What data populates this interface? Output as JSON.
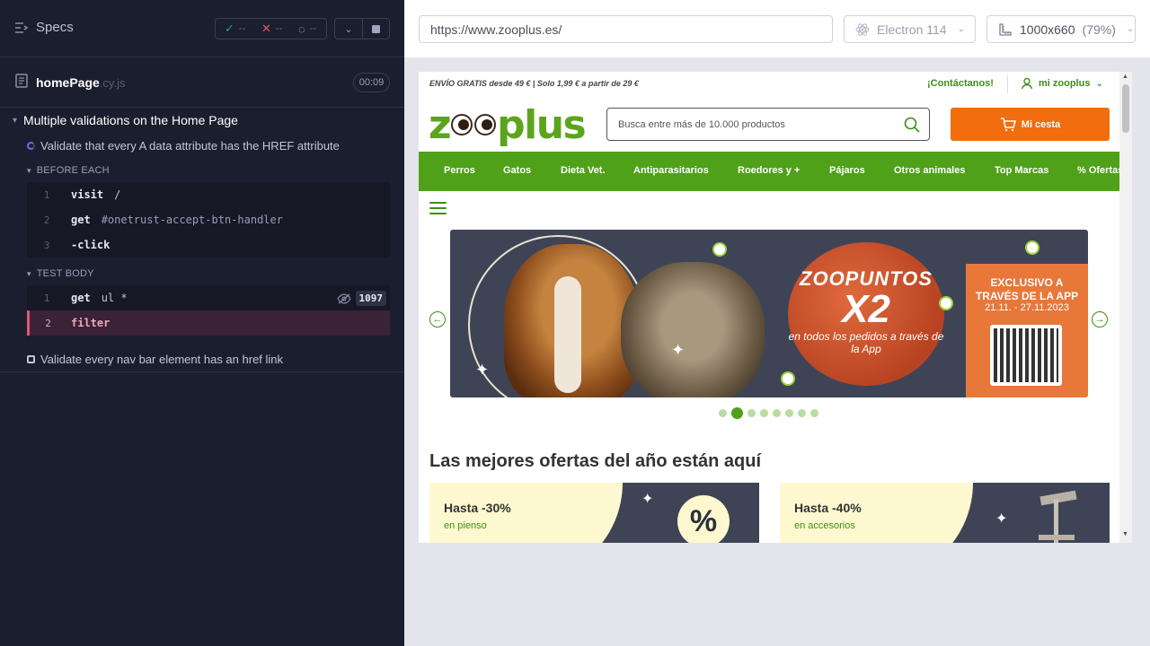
{
  "runner": {
    "header": {
      "title": "Specs"
    },
    "stats": {
      "passed": "--",
      "failed": "--",
      "pending": "--"
    },
    "file": {
      "name": "homePage",
      "ext": ".cy.js",
      "duration": "00:09"
    },
    "suite": {
      "title": "Multiple validations on the Home Page"
    },
    "tests": [
      {
        "title": "Validate that every A data attribute has the HREF attribute",
        "before_each_label": "BEFORE EACH",
        "before_each": [
          {
            "num": "1",
            "name": "visit",
            "arg": "/"
          },
          {
            "num": "2",
            "name": "get",
            "arg": "#onetrust-accept-btn-handler"
          },
          {
            "num": "3",
            "name": "-click",
            "arg": ""
          }
        ],
        "body_label": "TEST BODY",
        "body": [
          {
            "num": "1",
            "name": "get",
            "arg": "ul *",
            "count": "1097"
          },
          {
            "num": "2",
            "name": "filter",
            "arg": ""
          }
        ]
      },
      {
        "title": "Validate every nav bar element has an href link"
      }
    ]
  },
  "browser": {
    "url": "https://www.zooplus.es/",
    "engine": "Electron 114",
    "viewport": "1000x660",
    "zoom": "(79%)"
  },
  "site": {
    "promo": "ENVÍO GRATIS desde 49 € | Solo 1,99 € a partir de 29 €",
    "contact": "¡Contáctanos!",
    "account": "mi zooplus",
    "logo": {
      "pre": "z",
      "post": "plus"
    },
    "search_placeholder": "Busca entre más de 10.000 productos",
    "cart": "Mi cesta",
    "nav": [
      "Perros",
      "Gatos",
      "Dieta Vet.",
      "Antiparasitarios",
      "Roedores y +",
      "Pájaros",
      "Otros animales",
      "Top Marcas",
      "% Ofertas"
    ],
    "banner": {
      "title": "ZOOPUNTOS",
      "x2": "X2",
      "subtitle": "en todos los pedidos a través de la App",
      "exclusive": "EXCLUSIVO A TRAVÉS DE LA APP",
      "dates": "21.11. - 27.11.2023"
    },
    "carousel_dots": 8,
    "carousel_active": 2,
    "section_title": "Las mejores ofertas del año están aquí",
    "offers": [
      {
        "title": "Hasta -30%",
        "subtitle": "en pienso",
        "badge": "%"
      },
      {
        "title": "Hasta -40%",
        "subtitle": "en accesorios"
      }
    ]
  },
  "colors": {
    "runner_bg": "#1b1e2e",
    "zooplus_green": "#4fa119",
    "cart_orange": "#f26d0d",
    "failed_cmd": "#3a2238"
  }
}
